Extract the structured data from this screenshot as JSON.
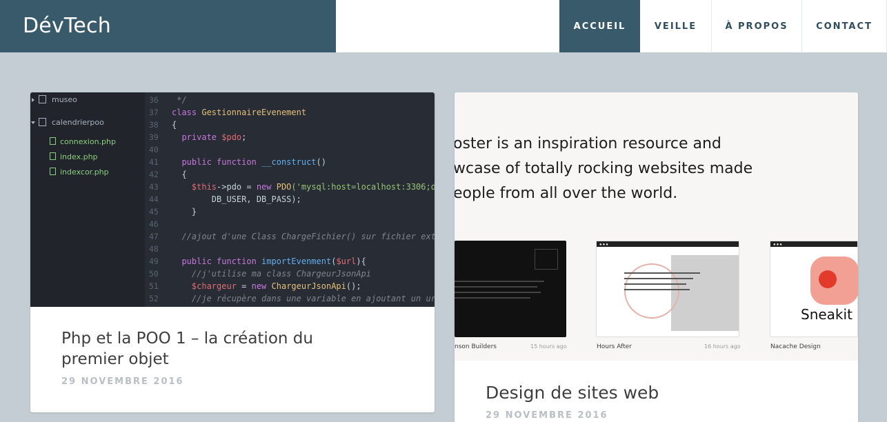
{
  "brand": {
    "title": "DévTech"
  },
  "nav": {
    "items": [
      {
        "label": "ACCUEIL",
        "active": true
      },
      {
        "label": "VEILLE"
      },
      {
        "label": "À PROPOS"
      },
      {
        "label": "CONTACT"
      }
    ]
  },
  "colors": {
    "accent": "#385a6b",
    "background": "#c4cdd3"
  },
  "posts": [
    {
      "title_line1": "Php et la POO 1 – la création du",
      "title_line2": "premier objet",
      "date": "29 NOVEMBRE 2016",
      "thumbnail": {
        "tree": {
          "folder1": "museo",
          "folder2": "calendrierpoo",
          "files": [
            "connexion.php",
            "index.php",
            "indexcor.php"
          ]
        },
        "line_numbers": [
          "36",
          "37",
          "38",
          "39",
          "40",
          "41",
          "42",
          "43",
          "44",
          "45",
          "46",
          "47",
          "48",
          "49",
          "50",
          "51",
          "52"
        ],
        "code": {
          "l36": " */",
          "l37_kw": "class ",
          "l37_cls": "GestionnaireEvenement",
          "l38": "{",
          "l39_kw": "  private ",
          "l39_var": "$pdo",
          "l39_end": ";",
          "l41_kw": "  public function ",
          "l41_fn": "__construct",
          "l41_end": "()",
          "l42": "  {",
          "l43_var": "    $this",
          "l43_mid": "->pdo = ",
          "l43_kw": "new ",
          "l43_cls": "PDO",
          "l43_str": "('mysql:host=localhost:3306;d",
          "l44": "        DB_USER, DB_PASS);",
          "l45": "    }",
          "l47_cm": "  //ajout d'une Class ChargeFichier() sur fichier ext",
          "l49_kw": "  public function ",
          "l49_fn": "importEvenment",
          "l49_mid": "(",
          "l49_var": "$url",
          "l49_end": "){",
          "l50_cm": "    //j'utilise ma class ChargeurJsonApi",
          "l51_var": "    $chargeur",
          "l51_mid": " = ",
          "l51_kw": "new ",
          "l51_cls": "ChargeurJsonApi",
          "l51_end": "();",
          "l52_cm": "    //je récupère dans une variable en ajoutant un ur"
        }
      }
    },
    {
      "title": "Design de sites web",
      "date": "29 NOVEMBRE 2016",
      "thumbnail": {
        "hero_lines": [
          "oster is an inspiration resource and",
          "wcase of totally rocking websites made",
          "eople from all over the world."
        ],
        "sites": [
          {
            "name": "nson Builders",
            "time": "15 hours ago"
          },
          {
            "name": "Hours After",
            "time": "16 hours ago"
          },
          {
            "name": "Nacache Design",
            "time": ""
          }
        ],
        "sneakit": "Sneakit"
      }
    }
  ]
}
